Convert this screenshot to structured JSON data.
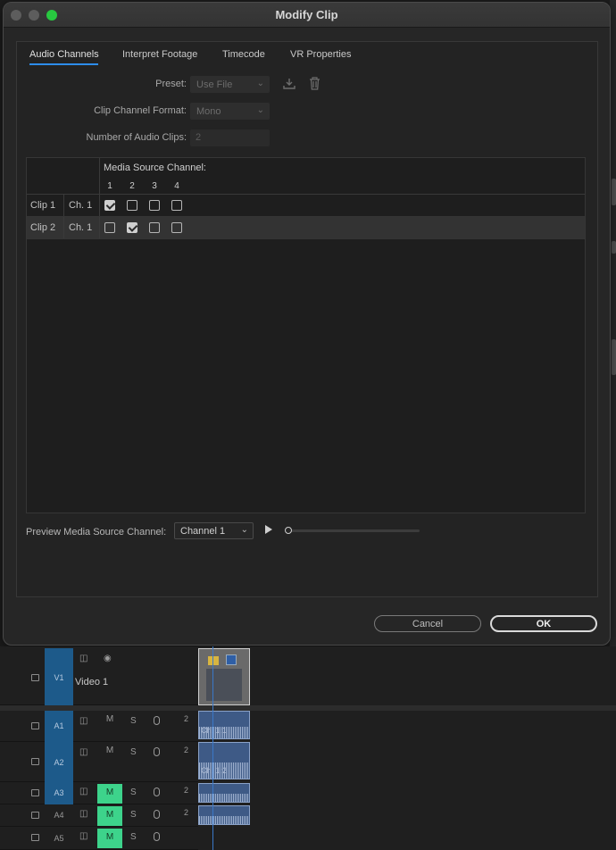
{
  "window": {
    "title": "Modify Clip"
  },
  "tabs": [
    "Audio Channels",
    "Interpret Footage",
    "Timecode",
    "VR Properties"
  ],
  "active_tab": "Audio Channels",
  "form": {
    "preset_label": "Preset:",
    "preset_value": "Use File",
    "format_label": "Clip Channel Format:",
    "format_value": "Mono",
    "num_clips_label": "Number of Audio Clips:",
    "num_clips_value": "2"
  },
  "grid": {
    "header_title": "Media Source Channel:",
    "channels": [
      "1",
      "2",
      "3",
      "4"
    ],
    "rows": [
      {
        "clip": "Clip 1",
        "channel": "Ch. 1",
        "checks": [
          true,
          false,
          false,
          false
        ]
      },
      {
        "clip": "Clip 2",
        "channel": "Ch. 1",
        "checks": [
          false,
          true,
          false,
          false
        ]
      }
    ]
  },
  "preview": {
    "label": "Preview Media Source Channel:",
    "channel": "Channel 1"
  },
  "buttons": {
    "cancel": "Cancel",
    "ok": "OK"
  },
  "timeline": {
    "tracks": [
      {
        "id": "V1",
        "name": "Video 1"
      },
      {
        "id": "A1",
        "m": "M",
        "s": "S",
        "count": "2"
      },
      {
        "id": "A2",
        "m": "M",
        "s": "S",
        "count": "2"
      },
      {
        "id": "A3",
        "m": "M",
        "s": "S",
        "count": "2"
      },
      {
        "id": "A4",
        "m": "M",
        "s": "S",
        "count": "2"
      },
      {
        "id": "A5",
        "m": "M",
        "s": "S"
      }
    ],
    "clip_labels": {
      "a1": "Ch. 1:1",
      "a2": "Ch. 1:2"
    }
  },
  "colors": {
    "accent": "#2d8ceb",
    "track_label": "#1d5a8a",
    "mute_on": "#3dd38b"
  }
}
